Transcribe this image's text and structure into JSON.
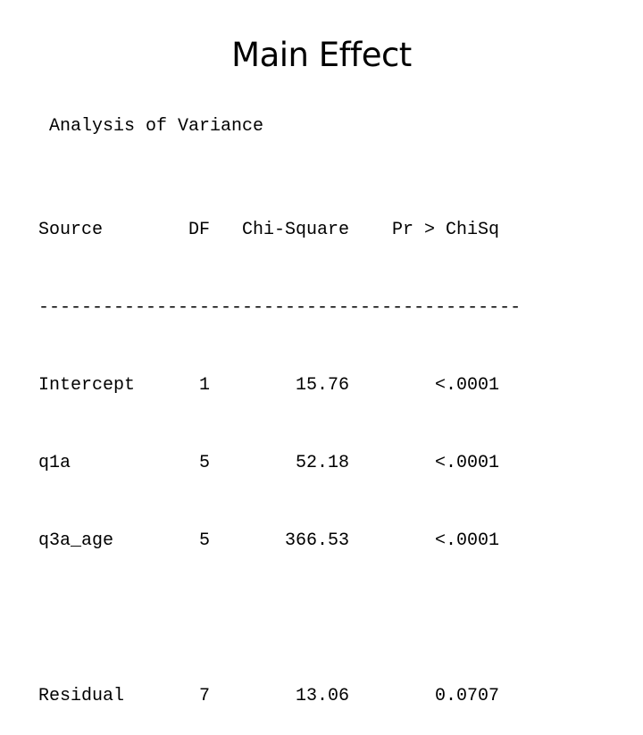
{
  "slide": {
    "title": "Main Effect",
    "subtitle": "Analysis of Variance"
  },
  "table": {
    "headers": [
      "Source",
      "DF",
      "Chi-Square",
      "Pr > ChiSq"
    ],
    "separator": "---------------------------------------------",
    "rows": [
      {
        "source": "Intercept",
        "df": "1",
        "chi_square": "15.76",
        "p": "<.0001"
      },
      {
        "source": "q1a",
        "df": "5",
        "chi_square": "52.18",
        "p": "<.0001"
      },
      {
        "source": "q3a_age",
        "df": "5",
        "chi_square": "366.53",
        "p": "<.0001"
      }
    ],
    "residual": {
      "source": "Residual",
      "df": "7",
      "chi_square": "13.06",
      "p": "0.0707"
    }
  }
}
